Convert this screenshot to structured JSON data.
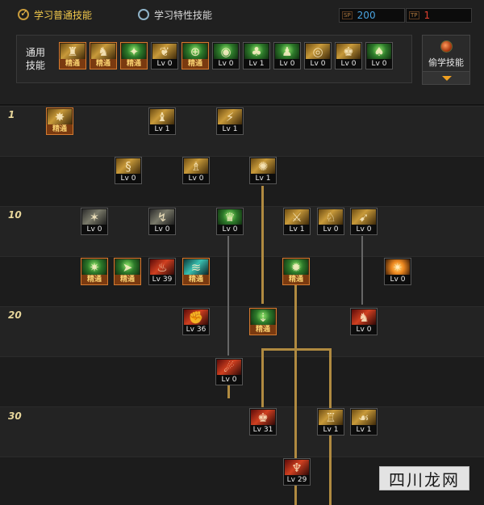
{
  "tabs": [
    {
      "label": "学习普通技能",
      "active": true
    },
    {
      "label": "学习特性技能",
      "active": false
    }
  ],
  "points": {
    "sp": {
      "tag": "SP",
      "value": "200"
    },
    "tp": {
      "tag": "TP",
      "value": "1"
    }
  },
  "common_skills": {
    "label": "通用技能",
    "items": [
      {
        "icon": "gold-figure-icon",
        "badge": "精通"
      },
      {
        "icon": "gold-kneel-icon",
        "badge": "精通"
      },
      {
        "icon": "green-run-icon",
        "badge": "精通"
      },
      {
        "icon": "gold-wings-icon",
        "badge": "Lv 0"
      },
      {
        "icon": "green-target-icon",
        "badge": "精通"
      },
      {
        "icon": "green-orb-icon",
        "badge": "Lv 0"
      },
      {
        "icon": "green-mushroom-icon",
        "badge": "Lv 1"
      },
      {
        "icon": "green-figure-icon",
        "badge": "Lv 0"
      },
      {
        "icon": "gold-eye-icon",
        "badge": "Lv 0"
      },
      {
        "icon": "gold-warrior-icon",
        "badge": "Lv 0"
      },
      {
        "icon": "green-spirit-icon",
        "badge": "Lv 0"
      }
    ]
  },
  "steal_skill": {
    "label": "偷学技能"
  },
  "levels": [
    "1",
    "10",
    "20",
    "30"
  ],
  "tree_skills": [
    {
      "icon": "gold-strike-icon",
      "badge": "精通"
    },
    {
      "icon": "gold-crouch-icon",
      "badge": "Lv 1"
    },
    {
      "icon": "gold-slash-icon",
      "badge": "Lv 1"
    },
    {
      "icon": "gold-chain-icon",
      "badge": "Lv 0"
    },
    {
      "icon": "gold-stance-icon",
      "badge": "Lv 0"
    },
    {
      "icon": "gold-burst-icon",
      "badge": "Lv 1"
    },
    {
      "icon": "grey-spin-icon",
      "badge": "Lv 0"
    },
    {
      "icon": "grey-kick-icon",
      "badge": "Lv 0"
    },
    {
      "icon": "green-armor-icon",
      "badge": "Lv 0"
    },
    {
      "icon": "gold-combo-icon",
      "badge": "Lv 1"
    },
    {
      "icon": "gold-leap-icon",
      "badge": "Lv 0"
    },
    {
      "icon": "gold-sweep-icon",
      "badge": "Lv 0"
    },
    {
      "icon": "green-smash-icon",
      "badge": "精通"
    },
    {
      "icon": "green-dash-icon",
      "badge": "精通"
    },
    {
      "icon": "red-flame-icon",
      "badge": "Lv 39"
    },
    {
      "icon": "teal-wave-icon",
      "badge": "精通"
    },
    {
      "icon": "green-explode-icon",
      "badge": "精通"
    },
    {
      "icon": "orange-blast-icon",
      "badge": "Lv 0"
    },
    {
      "icon": "red-fist-icon",
      "badge": "Lv 36"
    },
    {
      "icon": "green-ground-icon",
      "badge": "精通"
    },
    {
      "icon": "red-rush-icon",
      "badge": "Lv 0"
    },
    {
      "icon": "red-grab-icon",
      "badge": "Lv 0"
    },
    {
      "icon": "red-rage-icon",
      "badge": "Lv 31"
    },
    {
      "icon": "gold-guard-icon",
      "badge": "Lv 1"
    },
    {
      "icon": "gold-throw-icon",
      "badge": "Lv 1"
    },
    {
      "icon": "red-demon-icon",
      "badge": "Lv 29"
    }
  ]
}
